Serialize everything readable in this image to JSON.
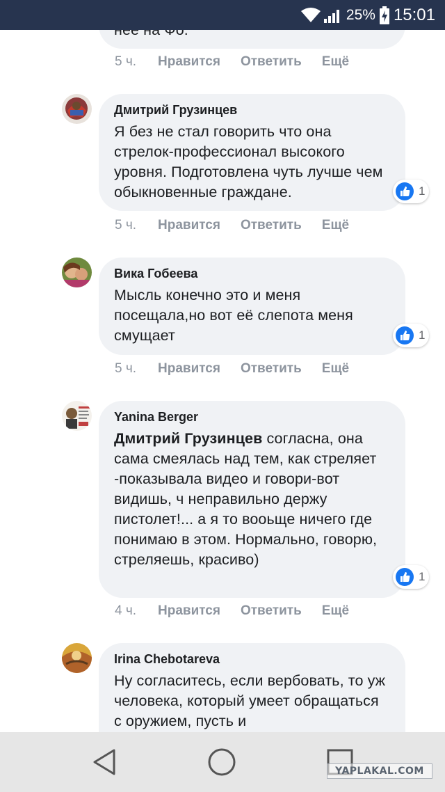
{
  "status_bar": {
    "battery": "25%",
    "time": "15:01"
  },
  "partial_top": {
    "text": "нее на Фо.",
    "time": "5 ч."
  },
  "actions": {
    "like": "Нравится",
    "reply": "Ответить",
    "more": "Ещё"
  },
  "comments": [
    {
      "author": "Дмитрий Грузинцев",
      "text": "Я без не стал говорить что она стрелок-профессионал высокого уровня. Подготовлена чуть лучше чем обыкновенные граждане.",
      "likes": "1",
      "time": "5 ч."
    },
    {
      "author": "Вика Гобеева",
      "text": "Мысль конечно это и меня посещала,но вот её слепота меня смущает",
      "likes": "1",
      "time": "5 ч."
    },
    {
      "author": "Yanina Berger",
      "mention": "Дмитрий Грузинцев",
      "text": "согласна, она сама смеялась над тем, как стреляет -показывала видео и говори-вот видишь, ч неправильно держу пистолет!... а я то вооьще ничего где понимаю в этом. Нормально, говорю, стреляешь, красиво)",
      "likes": "1",
      "time": "4 ч."
    },
    {
      "author": "Irina Chebotareva",
      "text": "Ну согласитесь, если вербовать, то уж человека, который умеет обращаться с оружием, пусть и"
    }
  ],
  "watermark": "YAPLAKAL.COM",
  "colors": {
    "status_bar": "#27344f",
    "bubble": "#f0f2f5",
    "like_blue": "#1877f2",
    "meta_gray": "#8d949e",
    "nav_bar": "#e6e6e6"
  }
}
